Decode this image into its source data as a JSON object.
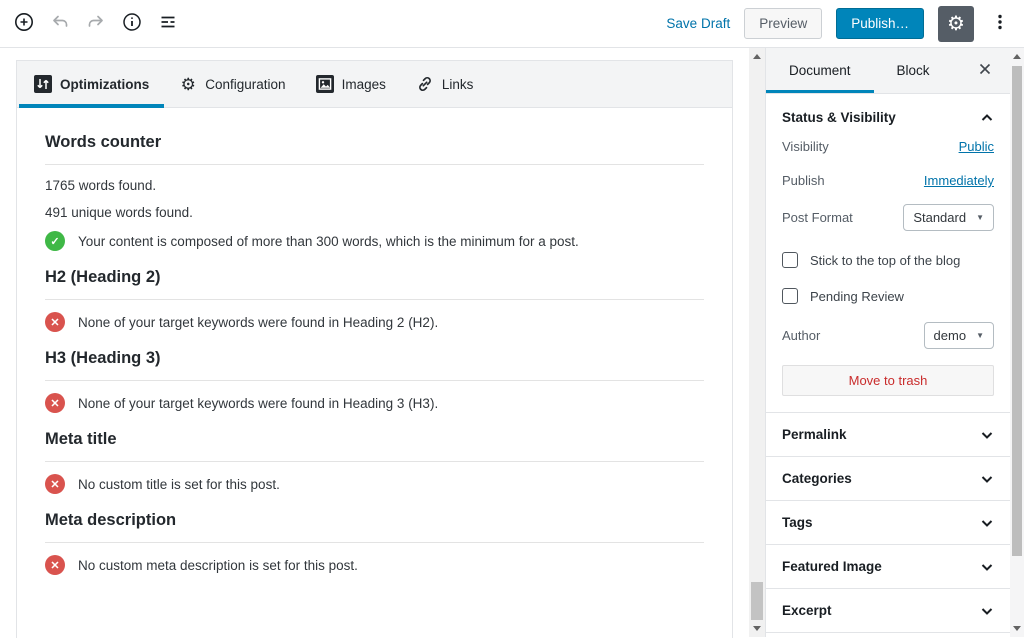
{
  "toolbar": {
    "save_draft": "Save Draft",
    "preview": "Preview",
    "publish": "Publish…"
  },
  "seo_box": {
    "tabs": [
      {
        "label": "Optimizations",
        "icon": "sliders-icon",
        "active": true
      },
      {
        "label": "Configuration",
        "icon": "gear-icon",
        "active": false
      },
      {
        "label": "Images",
        "icon": "image-icon",
        "active": false
      },
      {
        "label": "Links",
        "icon": "link-icon",
        "active": false
      }
    ],
    "sections": [
      {
        "title": "Words counter",
        "lines": [
          "1765 words found.",
          "491 unique words found."
        ],
        "checks": [
          {
            "status": "success",
            "text": "Your content is composed of more than 300 words, which is the minimum for a post."
          }
        ]
      },
      {
        "title": "H2 (Heading 2)",
        "lines": [],
        "checks": [
          {
            "status": "error",
            "text": "None of your target keywords were found in Heading 2 (H2)."
          }
        ]
      },
      {
        "title": "H3 (Heading 3)",
        "lines": [],
        "checks": [
          {
            "status": "error",
            "text": "None of your target keywords were found in Heading 3 (H3)."
          }
        ]
      },
      {
        "title": "Meta title",
        "lines": [],
        "checks": [
          {
            "status": "error",
            "text": "No custom title is set for this post."
          }
        ]
      },
      {
        "title": "Meta description",
        "lines": [],
        "checks": [
          {
            "status": "error",
            "text": "No custom meta description is set for this post."
          }
        ]
      }
    ]
  },
  "sidebar": {
    "tabs": [
      {
        "label": "Document",
        "active": true
      },
      {
        "label": "Block",
        "active": false
      }
    ],
    "status_panel": {
      "title": "Status & Visibility",
      "rows": [
        {
          "label": "Visibility",
          "value": "Public"
        },
        {
          "label": "Publish",
          "value": "Immediately"
        },
        {
          "label": "Post Format",
          "value": "Standard"
        }
      ],
      "checkboxes": [
        "Stick to the top of the blog",
        "Pending Review"
      ],
      "author_label": "Author",
      "author_value": "demo",
      "trash_button": "Move to trash"
    },
    "panels": [
      "Permalink",
      "Categories",
      "Tags",
      "Featured Image",
      "Excerpt"
    ]
  },
  "colors": {
    "accent": "#0085ba",
    "link": "#0073aa",
    "success": "#3fb846",
    "error": "#d9534e",
    "trash_text": "#c92c2c",
    "dark_button": "#555d66"
  }
}
